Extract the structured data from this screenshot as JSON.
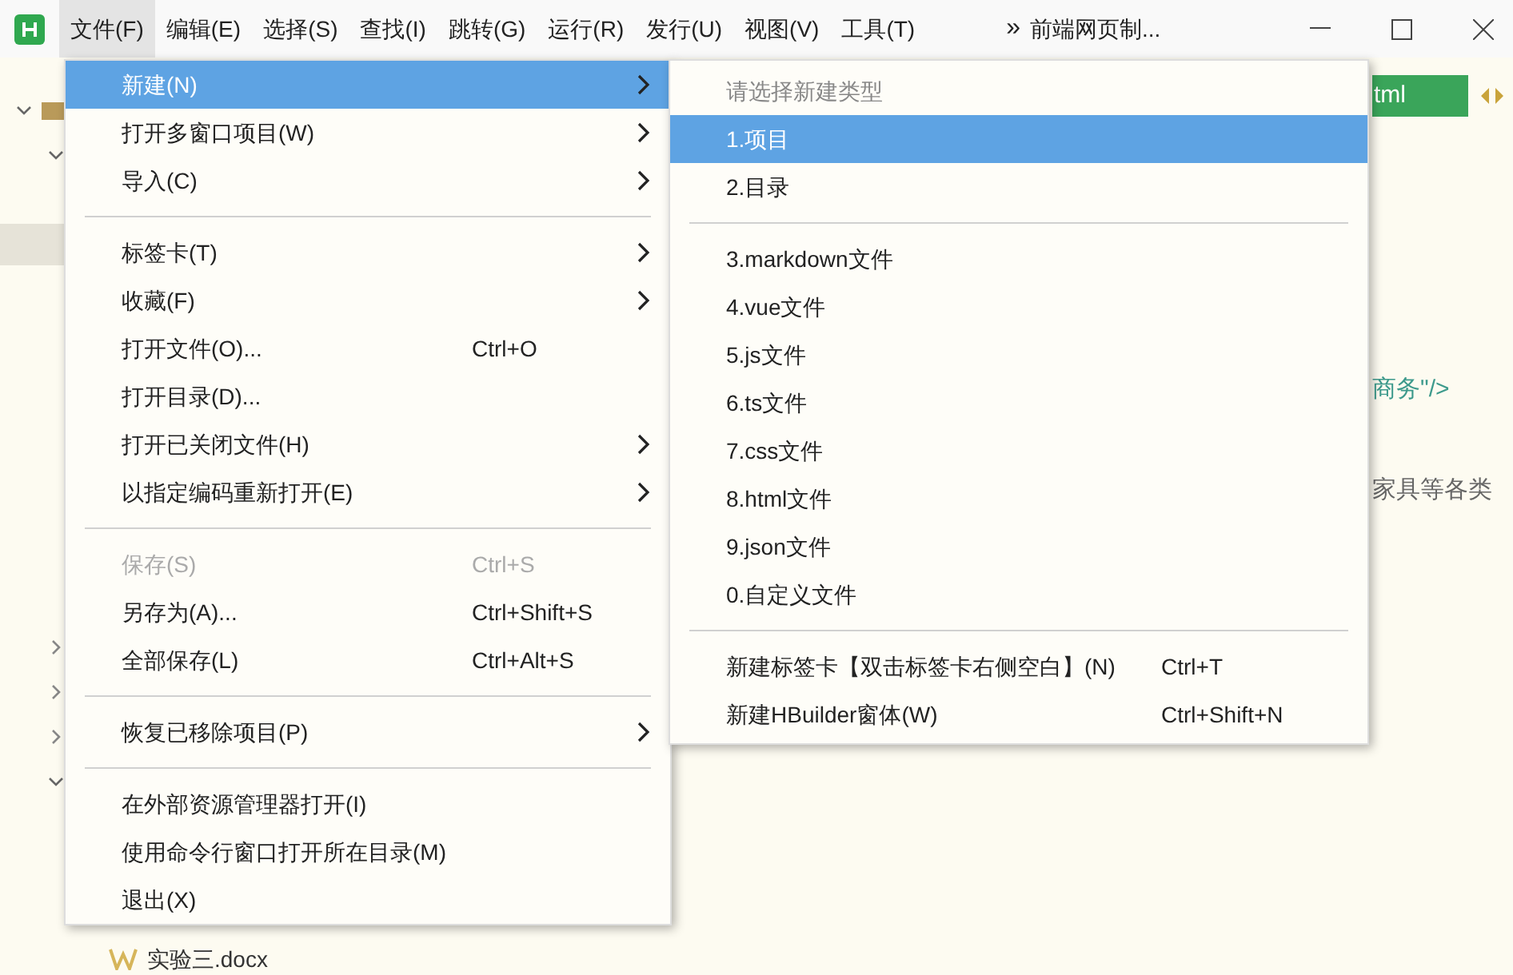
{
  "menubar": {
    "items": [
      {
        "label": "文件(F)",
        "selected": true
      },
      {
        "label": "编辑(E)",
        "selected": false
      },
      {
        "label": "选择(S)",
        "selected": false
      },
      {
        "label": "查找(I)",
        "selected": false
      },
      {
        "label": "跳转(G)",
        "selected": false
      },
      {
        "label": "运行(R)",
        "selected": false
      },
      {
        "label": "发行(U)",
        "selected": false
      },
      {
        "label": "视图(V)",
        "selected": false
      },
      {
        "label": "工具(T)",
        "selected": false
      }
    ],
    "overflow": "»",
    "project_title": "前端网页制..."
  },
  "sidebar": {
    "files": [
      {
        "name": "实验三.docx"
      }
    ]
  },
  "editor": {
    "tab": "tml",
    "lines": [
      "商务\"/>",
      "家具等各类"
    ]
  },
  "file_menu": [
    {
      "kind": "item",
      "label": "新建(N)",
      "submenu": true,
      "selected": true,
      "disabled": false
    },
    {
      "kind": "item",
      "label": "打开多窗口项目(W)",
      "submenu": true,
      "selected": false,
      "disabled": false
    },
    {
      "kind": "item",
      "label": "导入(C)",
      "submenu": true,
      "selected": false,
      "disabled": false
    },
    {
      "kind": "separator"
    },
    {
      "kind": "item",
      "label": "标签卡(T)",
      "submenu": true,
      "selected": false,
      "disabled": false
    },
    {
      "kind": "item",
      "label": "收藏(F)",
      "submenu": true,
      "selected": false,
      "disabled": false
    },
    {
      "kind": "item",
      "label": "打开文件(O)...",
      "shortcut": "Ctrl+O",
      "submenu": false,
      "selected": false,
      "disabled": false
    },
    {
      "kind": "item",
      "label": "打开目录(D)...",
      "submenu": false,
      "selected": false,
      "disabled": false
    },
    {
      "kind": "item",
      "label": "打开已关闭文件(H)",
      "submenu": true,
      "selected": false,
      "disabled": false
    },
    {
      "kind": "item",
      "label": "以指定编码重新打开(E)",
      "submenu": true,
      "selected": false,
      "disabled": false
    },
    {
      "kind": "separator"
    },
    {
      "kind": "item",
      "label": "保存(S)",
      "shortcut": "Ctrl+S",
      "submenu": false,
      "selected": false,
      "disabled": true
    },
    {
      "kind": "item",
      "label": "另存为(A)...",
      "shortcut": "Ctrl+Shift+S",
      "submenu": false,
      "selected": false,
      "disabled": false
    },
    {
      "kind": "item",
      "label": "全部保存(L)",
      "shortcut": "Ctrl+Alt+S",
      "submenu": false,
      "selected": false,
      "disabled": false
    },
    {
      "kind": "separator"
    },
    {
      "kind": "item",
      "label": "恢复已移除项目(P)",
      "submenu": true,
      "selected": false,
      "disabled": false
    },
    {
      "kind": "separator"
    },
    {
      "kind": "item",
      "label": "在外部资源管理器打开(I)",
      "submenu": false,
      "selected": false,
      "disabled": false
    },
    {
      "kind": "item",
      "label": "使用命令行窗口打开所在目录(M)",
      "submenu": false,
      "selected": false,
      "disabled": false
    },
    {
      "kind": "item",
      "label": "退出(X)",
      "submenu": false,
      "selected": false,
      "disabled": false
    }
  ],
  "new_submenu": [
    {
      "kind": "header",
      "label": "请选择新建类型"
    },
    {
      "kind": "item",
      "label": "1.项目",
      "selected": true
    },
    {
      "kind": "item",
      "label": "2.目录",
      "selected": false
    },
    {
      "kind": "separator"
    },
    {
      "kind": "item",
      "label": "3.markdown文件",
      "selected": false
    },
    {
      "kind": "item",
      "label": "4.vue文件",
      "selected": false
    },
    {
      "kind": "item",
      "label": "5.js文件",
      "selected": false
    },
    {
      "kind": "item",
      "label": "6.ts文件",
      "selected": false
    },
    {
      "kind": "item",
      "label": "7.css文件",
      "selected": false
    },
    {
      "kind": "item",
      "label": "8.html文件",
      "selected": false
    },
    {
      "kind": "item",
      "label": "9.json文件",
      "selected": false
    },
    {
      "kind": "item",
      "label": "0.自定义文件",
      "selected": false
    },
    {
      "kind": "separator"
    },
    {
      "kind": "item",
      "label": "新建标签卡【双击标签卡右侧空白】(N)",
      "shortcut": "Ctrl+T",
      "selected": false
    },
    {
      "kind": "item",
      "label": "新建HBuilder窗体(W)",
      "shortcut": "Ctrl+Shift+N",
      "selected": false
    }
  ]
}
